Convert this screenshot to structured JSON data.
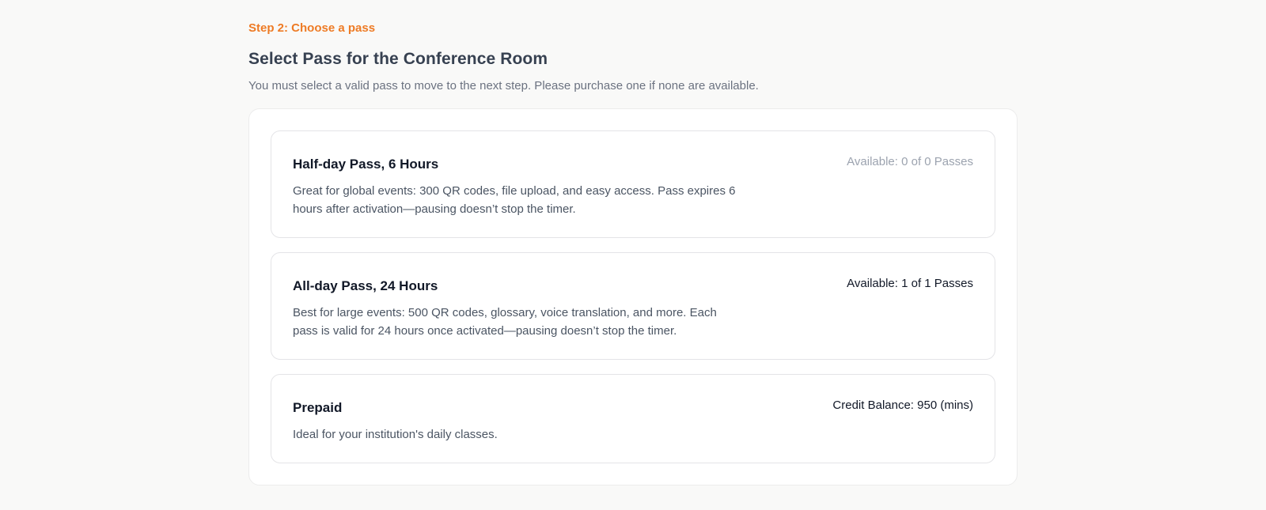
{
  "header": {
    "step_label": "Step 2: Choose a pass",
    "title": "Select Pass for the Conference Room",
    "subtitle": "You must select a valid pass to move to the next step. Please purchase one if none are available."
  },
  "passes": [
    {
      "name": "Half-day Pass, 6 Hours",
      "description": "Great for global events: 300 QR codes, file upload, and easy access. Pass expires 6 hours after activation—pausing doesn’t stop the timer.",
      "availability": "Available: 0 of 0 Passes",
      "available": false
    },
    {
      "name": "All-day Pass, 24 Hours",
      "description": "Best for large events: 500 QR codes, glossary, voice translation, and more. Each pass is valid for 24 hours once activated—pausing doesn’t stop the timer.",
      "availability": "Available: 1 of 1 Passes",
      "available": true
    },
    {
      "name": "Prepaid",
      "description": "Ideal for your institution's daily classes.",
      "availability": "Credit Balance: 950 (mins)",
      "available": true
    }
  ],
  "colors": {
    "accent": "#ee7b25",
    "background": "#f9f9f8",
    "card_border": "#e4e4e7",
    "muted_text": "#9ca3af"
  }
}
